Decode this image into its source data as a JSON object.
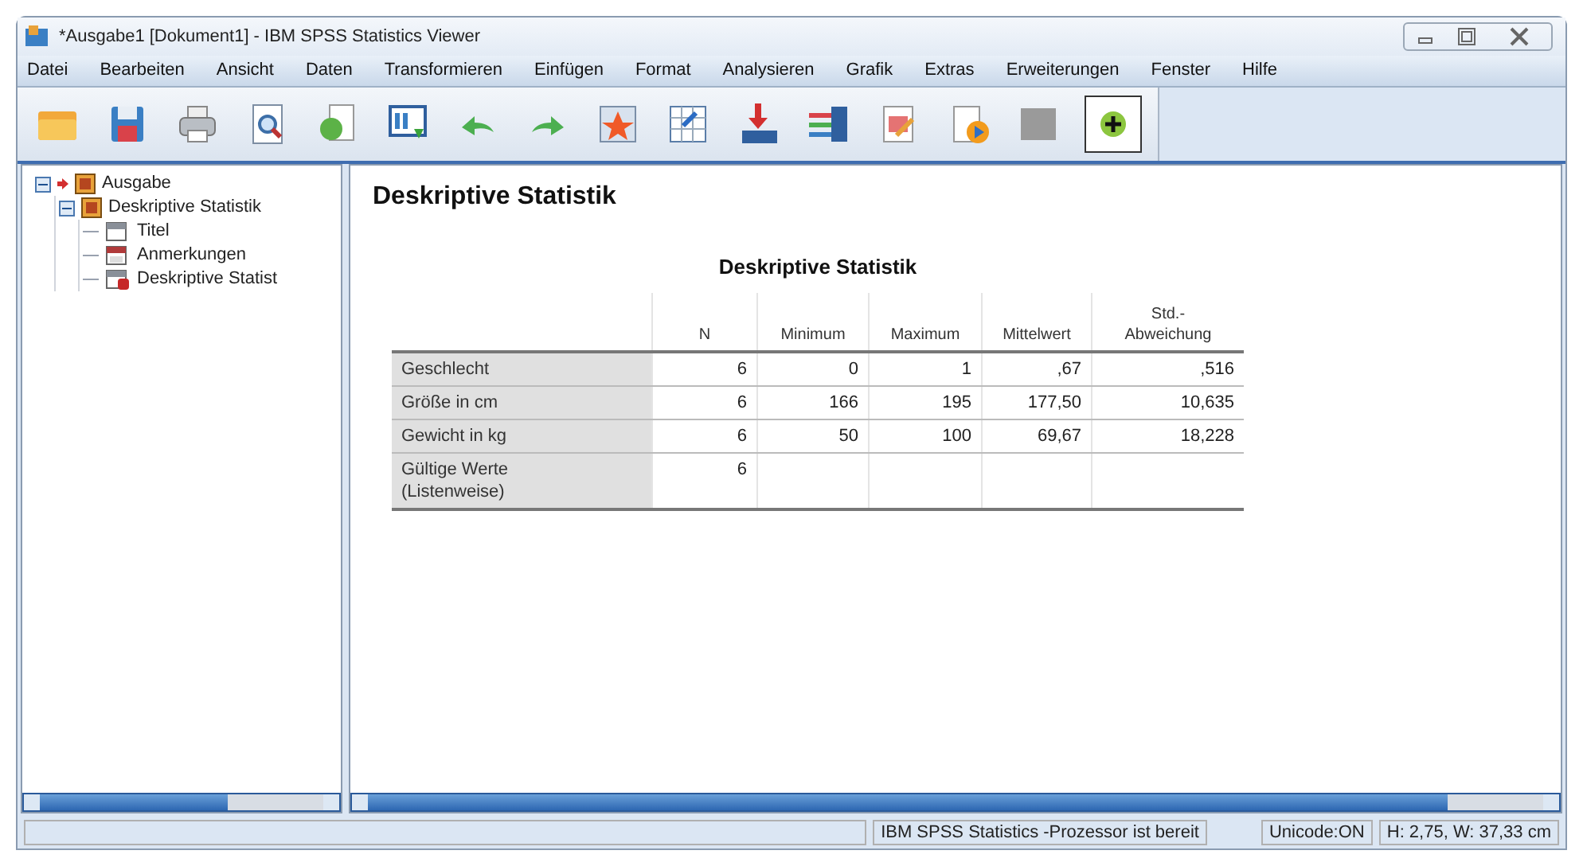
{
  "window": {
    "title": "*Ausgabe1 [Dokument1] - IBM SPSS Statistics Viewer"
  },
  "menu": [
    "Datei",
    "Bearbeiten",
    "Ansicht",
    "Daten",
    "Transformieren",
    "Einfügen",
    "Format",
    "Analysieren",
    "Grafik",
    "Extras",
    "Erweiterungen",
    "Fenster",
    "Hilfe"
  ],
  "outline": [
    {
      "label": "Ausgabe",
      "expanded": true,
      "children": [
        {
          "label": "Deskriptive Statistik",
          "expanded": true,
          "children": [
            {
              "label": "Titel",
              "kind": "title"
            },
            {
              "label": "Anmerkungen",
              "kind": "notes"
            },
            {
              "label": "Deskriptive Statist",
              "kind": "table"
            }
          ]
        }
      ]
    }
  ],
  "output": {
    "heading": "Deskriptive Statistik",
    "table": {
      "title": "Deskriptive Statistik",
      "columns": [
        "N",
        "Minimum",
        "Maximum",
        "Mittelwert",
        "Std.-\nAbweichung"
      ],
      "rows": [
        {
          "label": "Geschlecht",
          "cells": [
            "6",
            "0",
            "1",
            ",67",
            ",516"
          ]
        },
        {
          "label": "Größe in cm",
          "cells": [
            "6",
            "166",
            "195",
            "177,50",
            "10,635"
          ]
        },
        {
          "label": "Gewicht in kg",
          "cells": [
            "6",
            "50",
            "100",
            "69,67",
            "18,228"
          ]
        },
        {
          "label": "Gültige Werte\n(Listenweise)",
          "cells": [
            "6"
          ]
        }
      ]
    }
  },
  "status_bar": [
    "IBM SPSS Statistics -Prozessor ist bereit",
    "Unicode:ON",
    "H: 2,75, W: 37,33 cm"
  ]
}
